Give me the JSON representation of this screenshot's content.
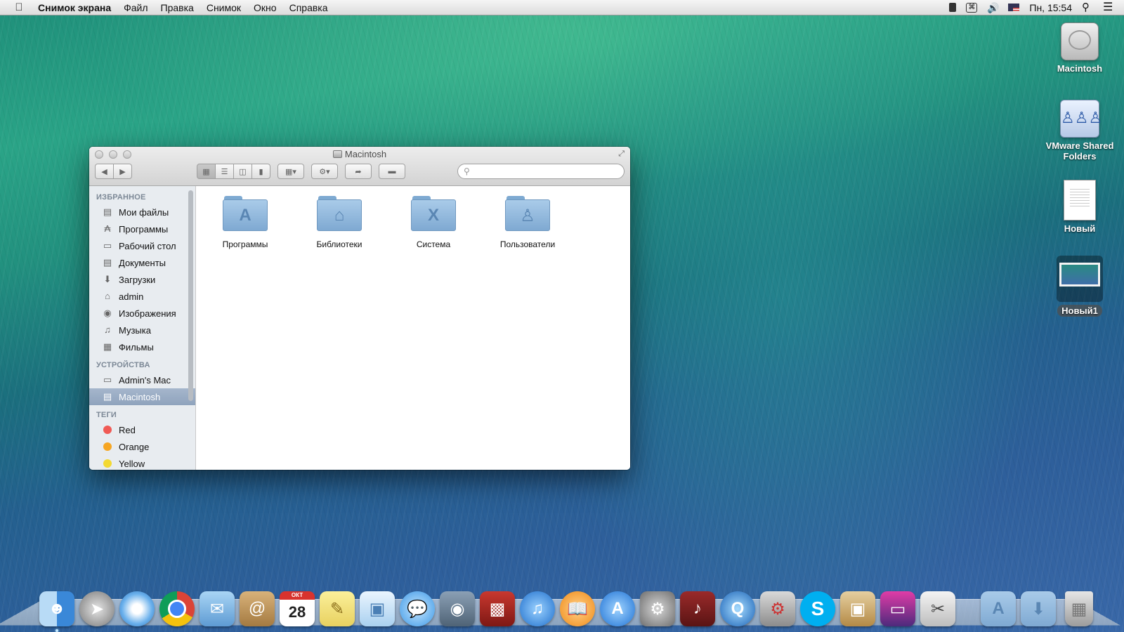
{
  "menubar": {
    "apple": "",
    "app_name": "Снимок экрана",
    "items": [
      "Файл",
      "Правка",
      "Снимок",
      "Окно",
      "Справка"
    ],
    "clock": "Пн, 15:54"
  },
  "desktop": {
    "icons": [
      {
        "label": "Macintosh",
        "icon": "hard-drive-icon"
      },
      {
        "label": "VMware Shared Folders",
        "icon": "network-drive-icon"
      },
      {
        "label": "Новый",
        "icon": "document-icon"
      },
      {
        "label": "Новый1",
        "icon": "screenshot-file-icon"
      }
    ]
  },
  "finder": {
    "title": "Macintosh",
    "search_placeholder": "",
    "sidebar": {
      "favorites_header": "ИЗБРАННОЕ",
      "favorites": [
        {
          "label": "Мои файлы",
          "icon": "all-files-icon"
        },
        {
          "label": "Программы",
          "icon": "applications-icon"
        },
        {
          "label": "Рабочий стол",
          "icon": "desktop-icon"
        },
        {
          "label": "Документы",
          "icon": "documents-icon"
        },
        {
          "label": "Загрузки",
          "icon": "downloads-icon"
        },
        {
          "label": "admin",
          "icon": "home-icon"
        },
        {
          "label": "Изображения",
          "icon": "pictures-icon"
        },
        {
          "label": "Музыка",
          "icon": "music-icon"
        },
        {
          "label": "Фильмы",
          "icon": "movies-icon"
        }
      ],
      "devices_header": "УСТРОЙСТВА",
      "devices": [
        {
          "label": "Admin's Mac",
          "icon": "computer-icon"
        },
        {
          "label": "Macintosh",
          "icon": "hard-drive-icon",
          "selected": true
        }
      ],
      "tags_header": "ТЕГИ",
      "tags": [
        {
          "label": "Red",
          "color": "#f05a55"
        },
        {
          "label": "Orange",
          "color": "#f6a623"
        },
        {
          "label": "Yellow",
          "color": "#f3d932"
        }
      ]
    },
    "folders": [
      {
        "label": "Программы",
        "icon": "applications-folder-icon"
      },
      {
        "label": "Библиотеки",
        "icon": "library-folder-icon"
      },
      {
        "label": "Система",
        "icon": "system-folder-icon"
      },
      {
        "label": "Пользователи",
        "icon": "users-folder-icon"
      }
    ]
  },
  "dock": {
    "calendar_month": "ОКТ",
    "calendar_day": "28",
    "apps": [
      "Finder",
      "Launchpad",
      "Safari",
      "Google Chrome",
      "Mail",
      "Contacts",
      "Calendar",
      "Notes",
      "Preview",
      "Messages",
      "FaceTime",
      "Photo Booth",
      "iTunes",
      "iBooks",
      "App Store",
      "System Preferences",
      "Dictionary",
      "QuickTime Player",
      "Automator",
      "Skype",
      "Installer",
      "Boot Camp",
      "Grab",
      "Applications",
      "Downloads",
      "Trash"
    ]
  },
  "colors": {
    "selection": "#8fa3bd",
    "folder_blue": "#7fa9d2",
    "sidebar_bg": "#e8ecf0"
  }
}
